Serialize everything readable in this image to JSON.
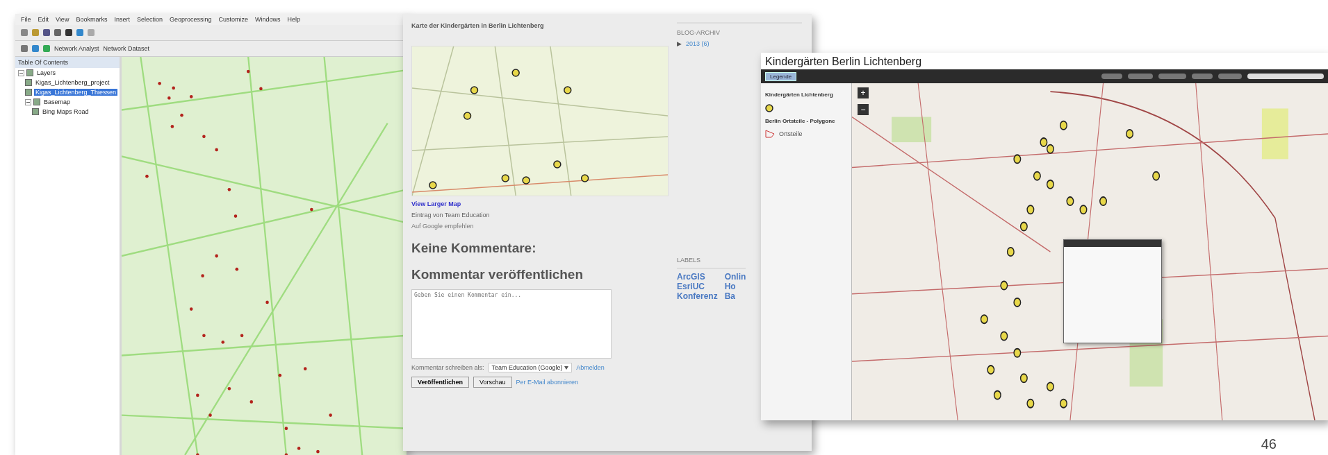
{
  "arcmap": {
    "menu": [
      "File",
      "Edit",
      "View",
      "Bookmarks",
      "Insert",
      "Selection",
      "Geoprocessing",
      "Customize",
      "Windows",
      "Help"
    ],
    "toolbar_labels": [
      "Network Analyst",
      "Network Dataset"
    ],
    "toc_title": "Table Of Contents",
    "layers": [
      {
        "label": "Layers",
        "checked": true,
        "expanded": true,
        "selected": false,
        "children": [
          {
            "label": "Kigas_Lichtenberg_project",
            "checked": true,
            "selected": false
          },
          {
            "label": "Kigas_Lichtenberg_Thiessen",
            "checked": true,
            "selected": true
          },
          {
            "label": "Basemap",
            "checked": true,
            "expanded": true,
            "selected": false,
            "children": [
              {
                "label": "Bing Maps Road",
                "checked": true,
                "selected": false
              }
            ]
          }
        ]
      }
    ]
  },
  "blog": {
    "title": "Karte der Kindergärten in Berlin Lichtenberg",
    "map_link": "View Larger Map",
    "author": "Eintrag von Team Education",
    "share": "Auf Google empfehlen",
    "no_comments": "Keine Kommentare:",
    "post_comment": "Kommentar veröffentlichen",
    "comment_placeholder": "Geben Sie einen Kommentar ein...",
    "comment_as": "Kommentar schreiben als:",
    "account": "Team Education (Google)",
    "sign_out": "Abmelden",
    "buttons": [
      "Veröffentlichen",
      "Vorschau"
    ],
    "subscribe": "Per E-Mail abonnieren",
    "sidebar": {
      "archive_title": "BLOG-ARCHIV",
      "archive": [
        {
          "toggle": "▶",
          "label": "2013 (6)",
          "expanded": false
        }
      ],
      "labels_title": "LABELS",
      "tags": [
        "ArcGIS",
        "Onlin",
        "EsriUC",
        "Ho",
        "Konferenz",
        "Ba"
      ]
    }
  },
  "webmap": {
    "title": "Kindergärten Berlin Lichtenberg",
    "legend_button": "Legende",
    "legend": [
      {
        "title": "Kindergärten Lichtenberg",
        "kind": "point"
      },
      {
        "title": "Berlin Ortsteile - Polygone",
        "kind": "polygon",
        "item": "Ortsteile"
      }
    ],
    "zoom": [
      "+",
      "−"
    ]
  },
  "page_number": "46"
}
